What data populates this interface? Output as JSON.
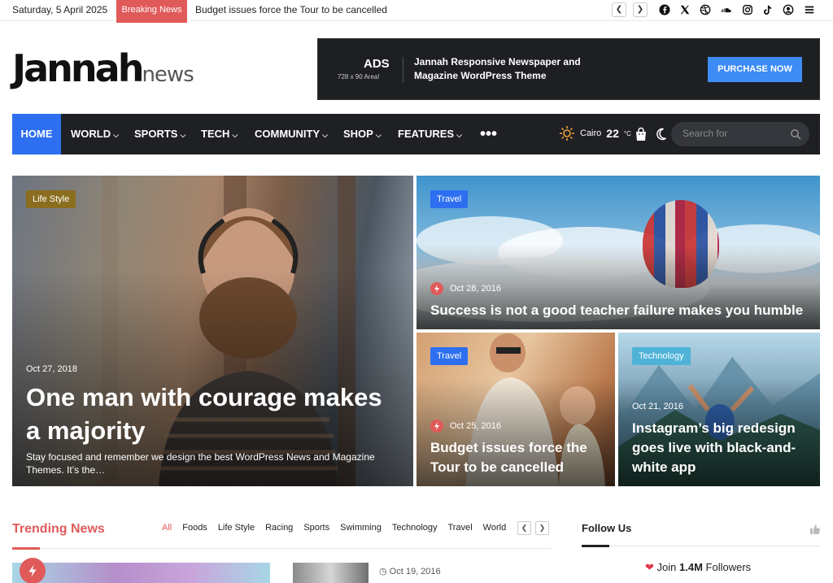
{
  "topbar": {
    "date": "Saturday, 5 April 2025",
    "breaking_label": "Breaking News",
    "ticker_text": "Budget issues force the Tour to be cancelled",
    "prev_icon": "chevron-left-icon",
    "next_icon": "chevron-right-icon",
    "social_icons": [
      "facebook-icon",
      "x-icon",
      "dribbble-icon",
      "soundcloud-icon",
      "instagram-icon",
      "tiktok-icon",
      "user-icon",
      "menu-icon"
    ]
  },
  "logo": {
    "main": "Jannah",
    "sub": "news"
  },
  "ad": {
    "title": "ADS",
    "size": "728 x 90 Area!",
    "text": "Jannah Responsive Newspaper and Magazine WordPress Theme",
    "button": "PURCHASE NOW"
  },
  "nav": {
    "items": [
      "HOME",
      "WORLD",
      "SPORTS",
      "TECH",
      "COMMUNITY",
      "SHOP",
      "FEATURES"
    ],
    "more": "•••",
    "weather_city": "Cairo",
    "weather_temp": "22",
    "weather_unit": "°C",
    "search_placeholder": "Search for"
  },
  "hero": {
    "main": {
      "category": "Life Style",
      "date": "Oct 27, 2018",
      "title": "One man with courage makes a majority",
      "excerpt": "Stay focused and remember we design the best WordPress News and Magazine Themes. It’s the…"
    },
    "top_right": {
      "category": "Travel",
      "date": "Oct 28, 2016",
      "title": "Success is not a good teacher failure makes you humble"
    },
    "bottom_left": {
      "category": "Travel",
      "date": "Oct 25, 2016",
      "title": "Budget issues force the Tour to be cancelled"
    },
    "bottom_right": {
      "category": "Technology",
      "date": "Oct 21, 2016",
      "title": "Instagram’s big redesign goes live with black-and-white app"
    }
  },
  "trending": {
    "title": "Trending News",
    "tabs": [
      "All",
      "Foods",
      "Life Style",
      "Racing",
      "Sports",
      "Swimming",
      "Technology",
      "Travel",
      "World"
    ],
    "date": "Oct 19, 2016"
  },
  "follow": {
    "title": "Follow Us",
    "join_prefix": "Join",
    "count": "1.4M",
    "suffix": "Followers"
  },
  "colors": {
    "accent_red": "#e05a5a",
    "nav_blue": "#2d6ff0",
    "nav_dark": "#1f2024",
    "lifestyle_badge": "#8b6d1f",
    "travel_badge": "#2d6ff0",
    "technology_badge": "#4fb3d8"
  }
}
